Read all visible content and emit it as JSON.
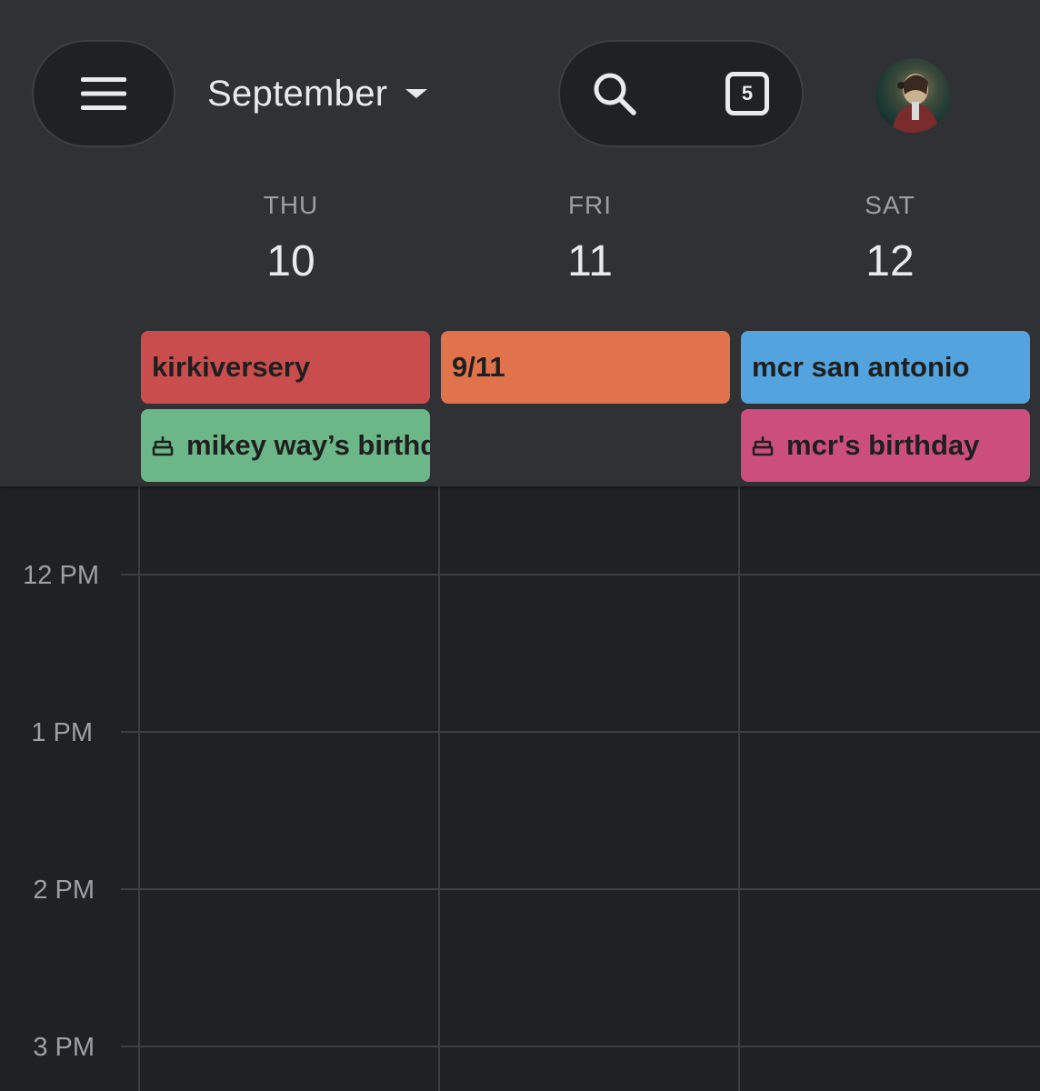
{
  "header": {
    "month": "September",
    "today_number": "5",
    "icons": {
      "menu": "hamburger-menu-icon",
      "month_caret": "caret-down-icon",
      "search": "search-icon",
      "today": "calendar-today-icon",
      "avatar": "profile-avatar"
    }
  },
  "days": [
    {
      "name": "THU",
      "number": "10"
    },
    {
      "name": "FRI",
      "number": "11"
    },
    {
      "name": "SAT",
      "number": "12"
    }
  ],
  "all_day_events": {
    "thu_1": {
      "title": "kirkiversery",
      "color": "#c94d4d"
    },
    "thu_2": {
      "title": "mikey way’s birthday",
      "color": "#6cb787",
      "icon": "birthday-cake-icon"
    },
    "fri_1": {
      "title": "9/11",
      "color": "#e1734c"
    },
    "sat_1": {
      "title": "mcr san antonio",
      "color": "#52a3de"
    },
    "sat_2": {
      "title": "mcr's birthday",
      "color": "#cc4e7c",
      "icon": "birthday-cake-icon"
    }
  },
  "time_slots": [
    "12 PM",
    "1 PM",
    "2 PM",
    "3 PM"
  ],
  "colors": {
    "background": "#202124",
    "header_background": "#303134",
    "grid_line": "#3c4043",
    "text_primary": "#e8eaed",
    "text_secondary": "#9aa0a6"
  }
}
